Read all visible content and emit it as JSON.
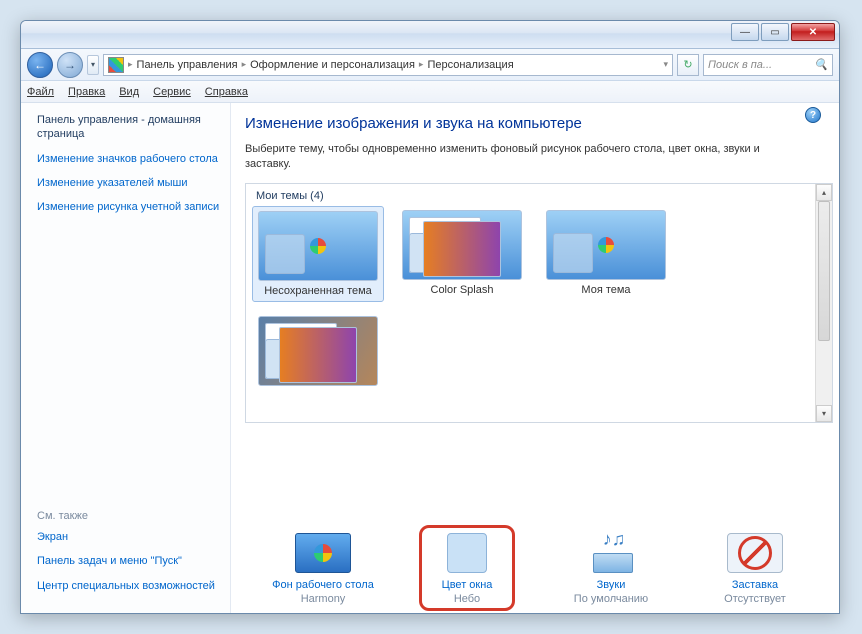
{
  "breadcrumb": {
    "seg1": "Панель управления",
    "seg2": "Оформление и персонализация",
    "seg3": "Персонализация"
  },
  "search": {
    "placeholder": "Поиск в па..."
  },
  "menu": {
    "file": "Файл",
    "edit": "Правка",
    "view": "Вид",
    "service": "Сервис",
    "help": "Справка"
  },
  "sidebar": {
    "head": "Панель управления - домашняя страница",
    "links": [
      "Изменение значков рабочего стола",
      "Изменение указателей мыши",
      "Изменение рисунка учетной записи"
    ],
    "see_also": "См. также",
    "bottom_links": [
      "Экран",
      "Панель задач и меню \"Пуск\"",
      "Центр специальных возможностей"
    ]
  },
  "main": {
    "title": "Изменение изображения и звука на компьютере",
    "desc": "Выберите тему, чтобы одновременно изменить фоновый рисунок рабочего стола, цвет окна, звуки и заставку.",
    "themes_label": "Мои темы (4)",
    "themes": [
      {
        "label": "Несохраненная тема"
      },
      {
        "label": "Color Splash"
      },
      {
        "label": "Моя тема"
      }
    ]
  },
  "bottom": {
    "items": [
      {
        "title": "Фон рабочего стола",
        "sub": "Harmony"
      },
      {
        "title": "Цвет окна",
        "sub": "Небо"
      },
      {
        "title": "Звуки",
        "sub": "По умолчанию"
      },
      {
        "title": "Заставка",
        "sub": "Отсутствует"
      }
    ]
  }
}
